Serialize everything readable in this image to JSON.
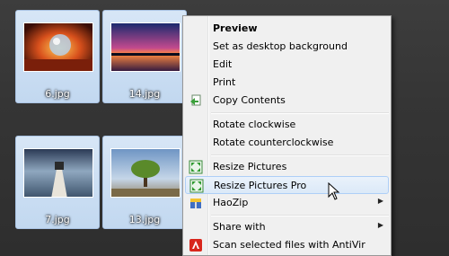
{
  "files": [
    {
      "name": "6.jpg"
    },
    {
      "name": "14.jpg"
    },
    {
      "name": "7.jpg"
    },
    {
      "name": "13.jpg"
    }
  ],
  "context_menu": {
    "items": [
      {
        "label": "Preview",
        "bold": true
      },
      {
        "label": "Set as desktop background"
      },
      {
        "label": "Edit"
      },
      {
        "label": "Print"
      },
      {
        "label": "Copy Contents",
        "icon": "copy-contents-icon"
      },
      {
        "label": "Rotate clockwise"
      },
      {
        "label": "Rotate counterclockwise"
      },
      {
        "label": "Resize Pictures",
        "icon": "resize-pictures-icon"
      },
      {
        "label": "Resize Pictures Pro",
        "icon": "resize-pictures-pro-icon",
        "highlighted": true
      },
      {
        "label": "HaoZip",
        "icon": "haozip-icon",
        "submenu": true
      },
      {
        "label": "Share with",
        "submenu": true
      },
      {
        "label": "Scan selected files with AntiVir",
        "icon": "antivir-icon"
      }
    ]
  },
  "colors": {
    "desktop": "#353535",
    "selection": "#c2d8f0",
    "menu_background": "#f0f0f0",
    "menu_highlight": "#dbe9f8"
  }
}
